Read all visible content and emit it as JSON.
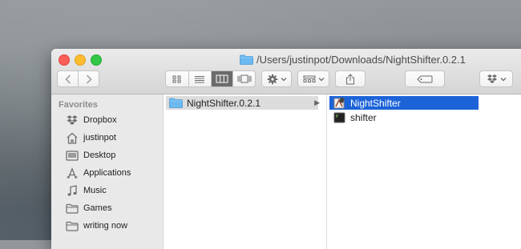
{
  "window": {
    "title": "/Users/justinpot/Downloads/NightShifter.0.2.1"
  },
  "toolbar": {
    "back_icon": "chevron-left-icon",
    "forward_icon": "chevron-right-icon",
    "view_modes": [
      "icon-view",
      "list-view",
      "column-view",
      "cover-flow-view"
    ],
    "active_view": "column-view",
    "action_icon": "gear-icon",
    "arrange_icon": "arrange-icon",
    "share_icon": "share-icon",
    "tag_icon": "tag-icon",
    "dropbox_icon": "dropbox-icon"
  },
  "sidebar": {
    "heading": "Favorites",
    "items": [
      {
        "label": "Dropbox",
        "icon": "dropbox-icon"
      },
      {
        "label": "justinpot",
        "icon": "home-icon"
      },
      {
        "label": "Desktop",
        "icon": "desktop-icon"
      },
      {
        "label": "Applications",
        "icon": "applications-icon"
      },
      {
        "label": "Music",
        "icon": "music-icon"
      },
      {
        "label": "Games",
        "icon": "folder-icon"
      },
      {
        "label": "writing now",
        "icon": "folder-icon"
      }
    ]
  },
  "columns": [
    {
      "items": [
        {
          "label": "NightShifter.0.2.1",
          "icon": "folder-icon",
          "selected": true
        }
      ]
    },
    {
      "items": [
        {
          "label": "NightShifter",
          "icon": "app-icon",
          "selected": true
        },
        {
          "label": "shifter",
          "icon": "terminal-icon",
          "selected": false
        }
      ]
    }
  ],
  "colors": {
    "selection_blue": "#1c63d8",
    "folder_blue": "#5fb3f0",
    "selection_gray": "#dcdcdc"
  }
}
